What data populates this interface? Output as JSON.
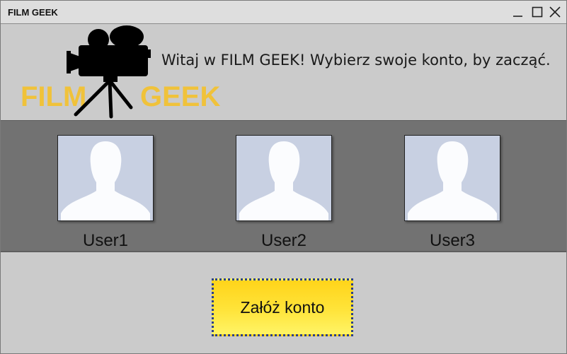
{
  "window": {
    "title": "FILM GEEK",
    "controls": [
      "minimize-icon",
      "maximize-icon",
      "close-icon"
    ]
  },
  "header": {
    "welcome_text": "Witaj w FILM GEEK! Wybierz swoje konto, by zacząć.",
    "logo_word_left": "FILM",
    "logo_word_right": "GEEK",
    "logo_icon": "movie-camera-icon",
    "logo_color": "#f0c23a"
  },
  "users": [
    {
      "name": "User1",
      "avatar_icon": "user-silhouette-icon"
    },
    {
      "name": "User2",
      "avatar_icon": "user-silhouette-icon"
    },
    {
      "name": "User3",
      "avatar_icon": "user-silhouette-icon"
    }
  ],
  "actions": {
    "create_account_label": "Załóż konto",
    "create_account_color": "#ffd41a"
  },
  "colors": {
    "background": "#cbcbcb",
    "users_band": "#727272",
    "avatar_bg": "#c8d0e2"
  }
}
